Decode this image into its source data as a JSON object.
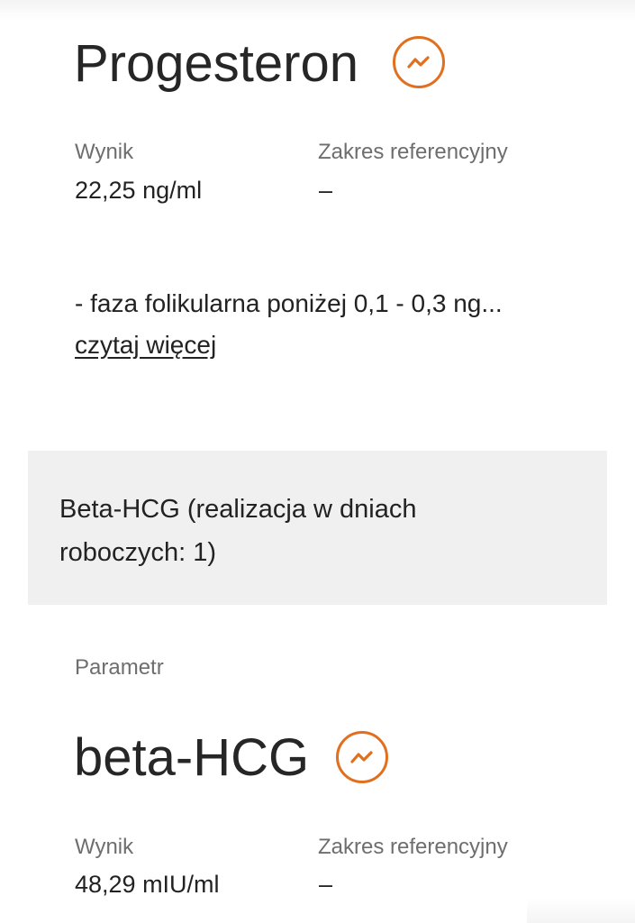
{
  "param1": {
    "title": "Progesteron",
    "result_label": "Wynik",
    "result_value": "22,25 ng/ml",
    "range_label": "Zakres referencyjny",
    "range_value": "–",
    "description": "- faza folikularna poniżej 0,1 - 0,3 ng...",
    "read_more": "czytaj więcej",
    "trend_icon": "trend-chart-icon"
  },
  "section": {
    "title": "Beta-HCG (realizacja w dniach roboczych: 1)"
  },
  "param2": {
    "caption": "Parametr",
    "title": "beta-HCG",
    "result_label": "Wynik",
    "result_value": "48,29 mIU/ml",
    "range_label": "Zakres referencyjny",
    "range_value": "–",
    "trend_icon": "trend-chart-icon"
  },
  "colors": {
    "accent": "#e07020",
    "section_bg": "#f0f0f0",
    "label": "#6e6e6e",
    "text": "#222222"
  }
}
